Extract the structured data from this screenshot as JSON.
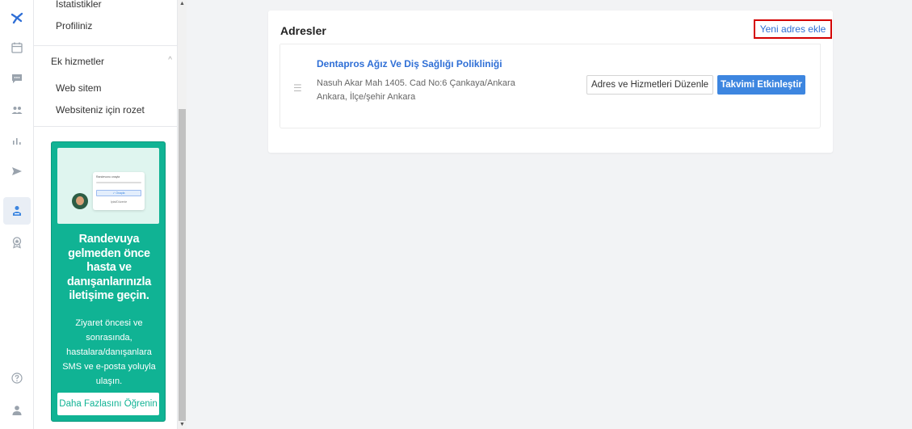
{
  "rail": {
    "icons": [
      "logo-icon",
      "calendar-icon",
      "chat-icon",
      "patients-icon",
      "stats-icon",
      "send-icon",
      "doctor-icon",
      "award-icon",
      "help-icon",
      "user-icon"
    ],
    "active": "doctor-icon"
  },
  "subnav": {
    "items_top": [
      "İstatistikler",
      "Profiliniz"
    ],
    "section": {
      "title": "Ek hizmetler",
      "items": [
        "Web sitem",
        "Websiteniz için rozet"
      ]
    },
    "promo": {
      "mini_card_title": "Randevunu onayla",
      "mini_card_button": "✓ Onayla",
      "mini_card_link": "İptal/Düzenle",
      "title": "Randevuya gelmeden önce hasta ve danışanlarınızla iletişime geçin.",
      "body": "Ziyaret öncesi ve sonrasında, hastalara/danışanlara SMS ve e-posta yoluyla ulaşın.",
      "button": "Daha Fazlasını Öğrenin"
    }
  },
  "addresses": {
    "title": "Adresler",
    "add_link": "Yeni adres ekle",
    "items": [
      {
        "name": "Dentapros Ağız Ve Diş Sağlığı Polikliniği",
        "line1": "Nasuh Akar Mah 1405. Cad No:6 Çankaya/Ankara",
        "line2": "Ankara, İlçe/şehir Ankara",
        "edit_button": "Adres ve Hizmetleri Düzenle",
        "activate_button": "Takvimi Etkinleştir"
      }
    ]
  },
  "colors": {
    "accent": "#3d86e0",
    "promo": "#10b394",
    "highlight": "#d40000"
  }
}
